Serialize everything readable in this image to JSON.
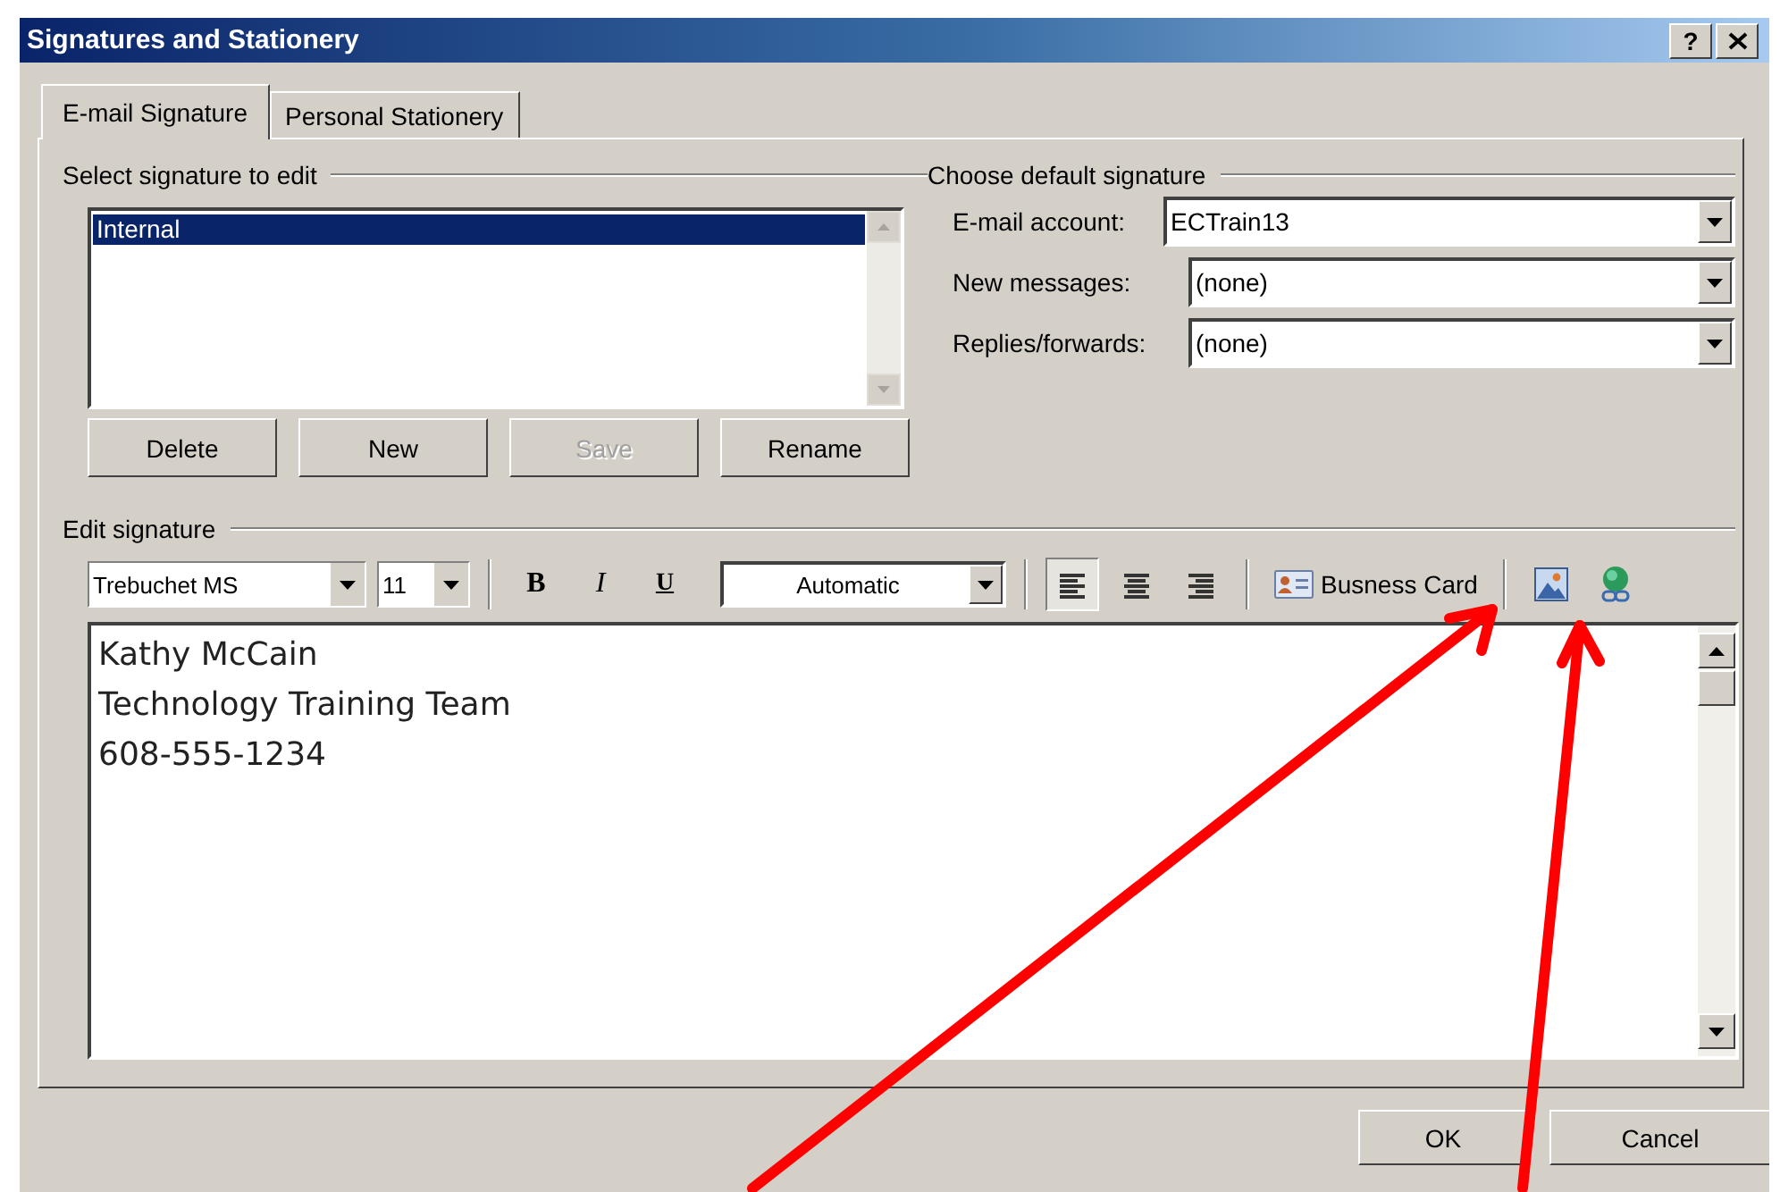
{
  "window": {
    "title": "Signatures and Stationery",
    "help": "?"
  },
  "tabs": [
    {
      "label": "E-mail Signature",
      "selected": true
    },
    {
      "label": "Personal Stationery",
      "selected": false
    }
  ],
  "select_signature": {
    "label": "Select signature to edit",
    "items": [
      {
        "label": "Internal",
        "selected": true
      }
    ],
    "buttons": [
      {
        "label": "Delete",
        "disabled": false
      },
      {
        "label": "New",
        "disabled": false
      },
      {
        "label": "Save",
        "disabled": true
      },
      {
        "label": "Rename",
        "disabled": false
      }
    ]
  },
  "default_signature": {
    "label": "Choose default signature",
    "fields": [
      {
        "label": "E-mail account:",
        "value": "ECTrain13"
      },
      {
        "label": "New messages:",
        "value": "(none)"
      },
      {
        "label": "Replies/forwards:",
        "value": "(none)"
      }
    ]
  },
  "edit_signature": {
    "label": "Edit signature",
    "font": "Trebuchet MS",
    "size": "11",
    "formatting": [
      {
        "kind": "bold",
        "label": "B"
      },
      {
        "kind": "italic",
        "label": "I"
      },
      {
        "kind": "underline",
        "label": "U"
      }
    ],
    "font_color_choice": "Automatic",
    "alignments": [
      {
        "kind": "left",
        "selected": true
      },
      {
        "kind": "center",
        "selected": false
      },
      {
        "kind": "right",
        "selected": false
      }
    ],
    "business_card": "Busness Card",
    "lines": [
      "Kathy McCain",
      "Technology Training Team",
      "608-555-1234"
    ]
  },
  "buttons": [
    {
      "label": "OK"
    },
    {
      "label": "Cancel"
    }
  ]
}
